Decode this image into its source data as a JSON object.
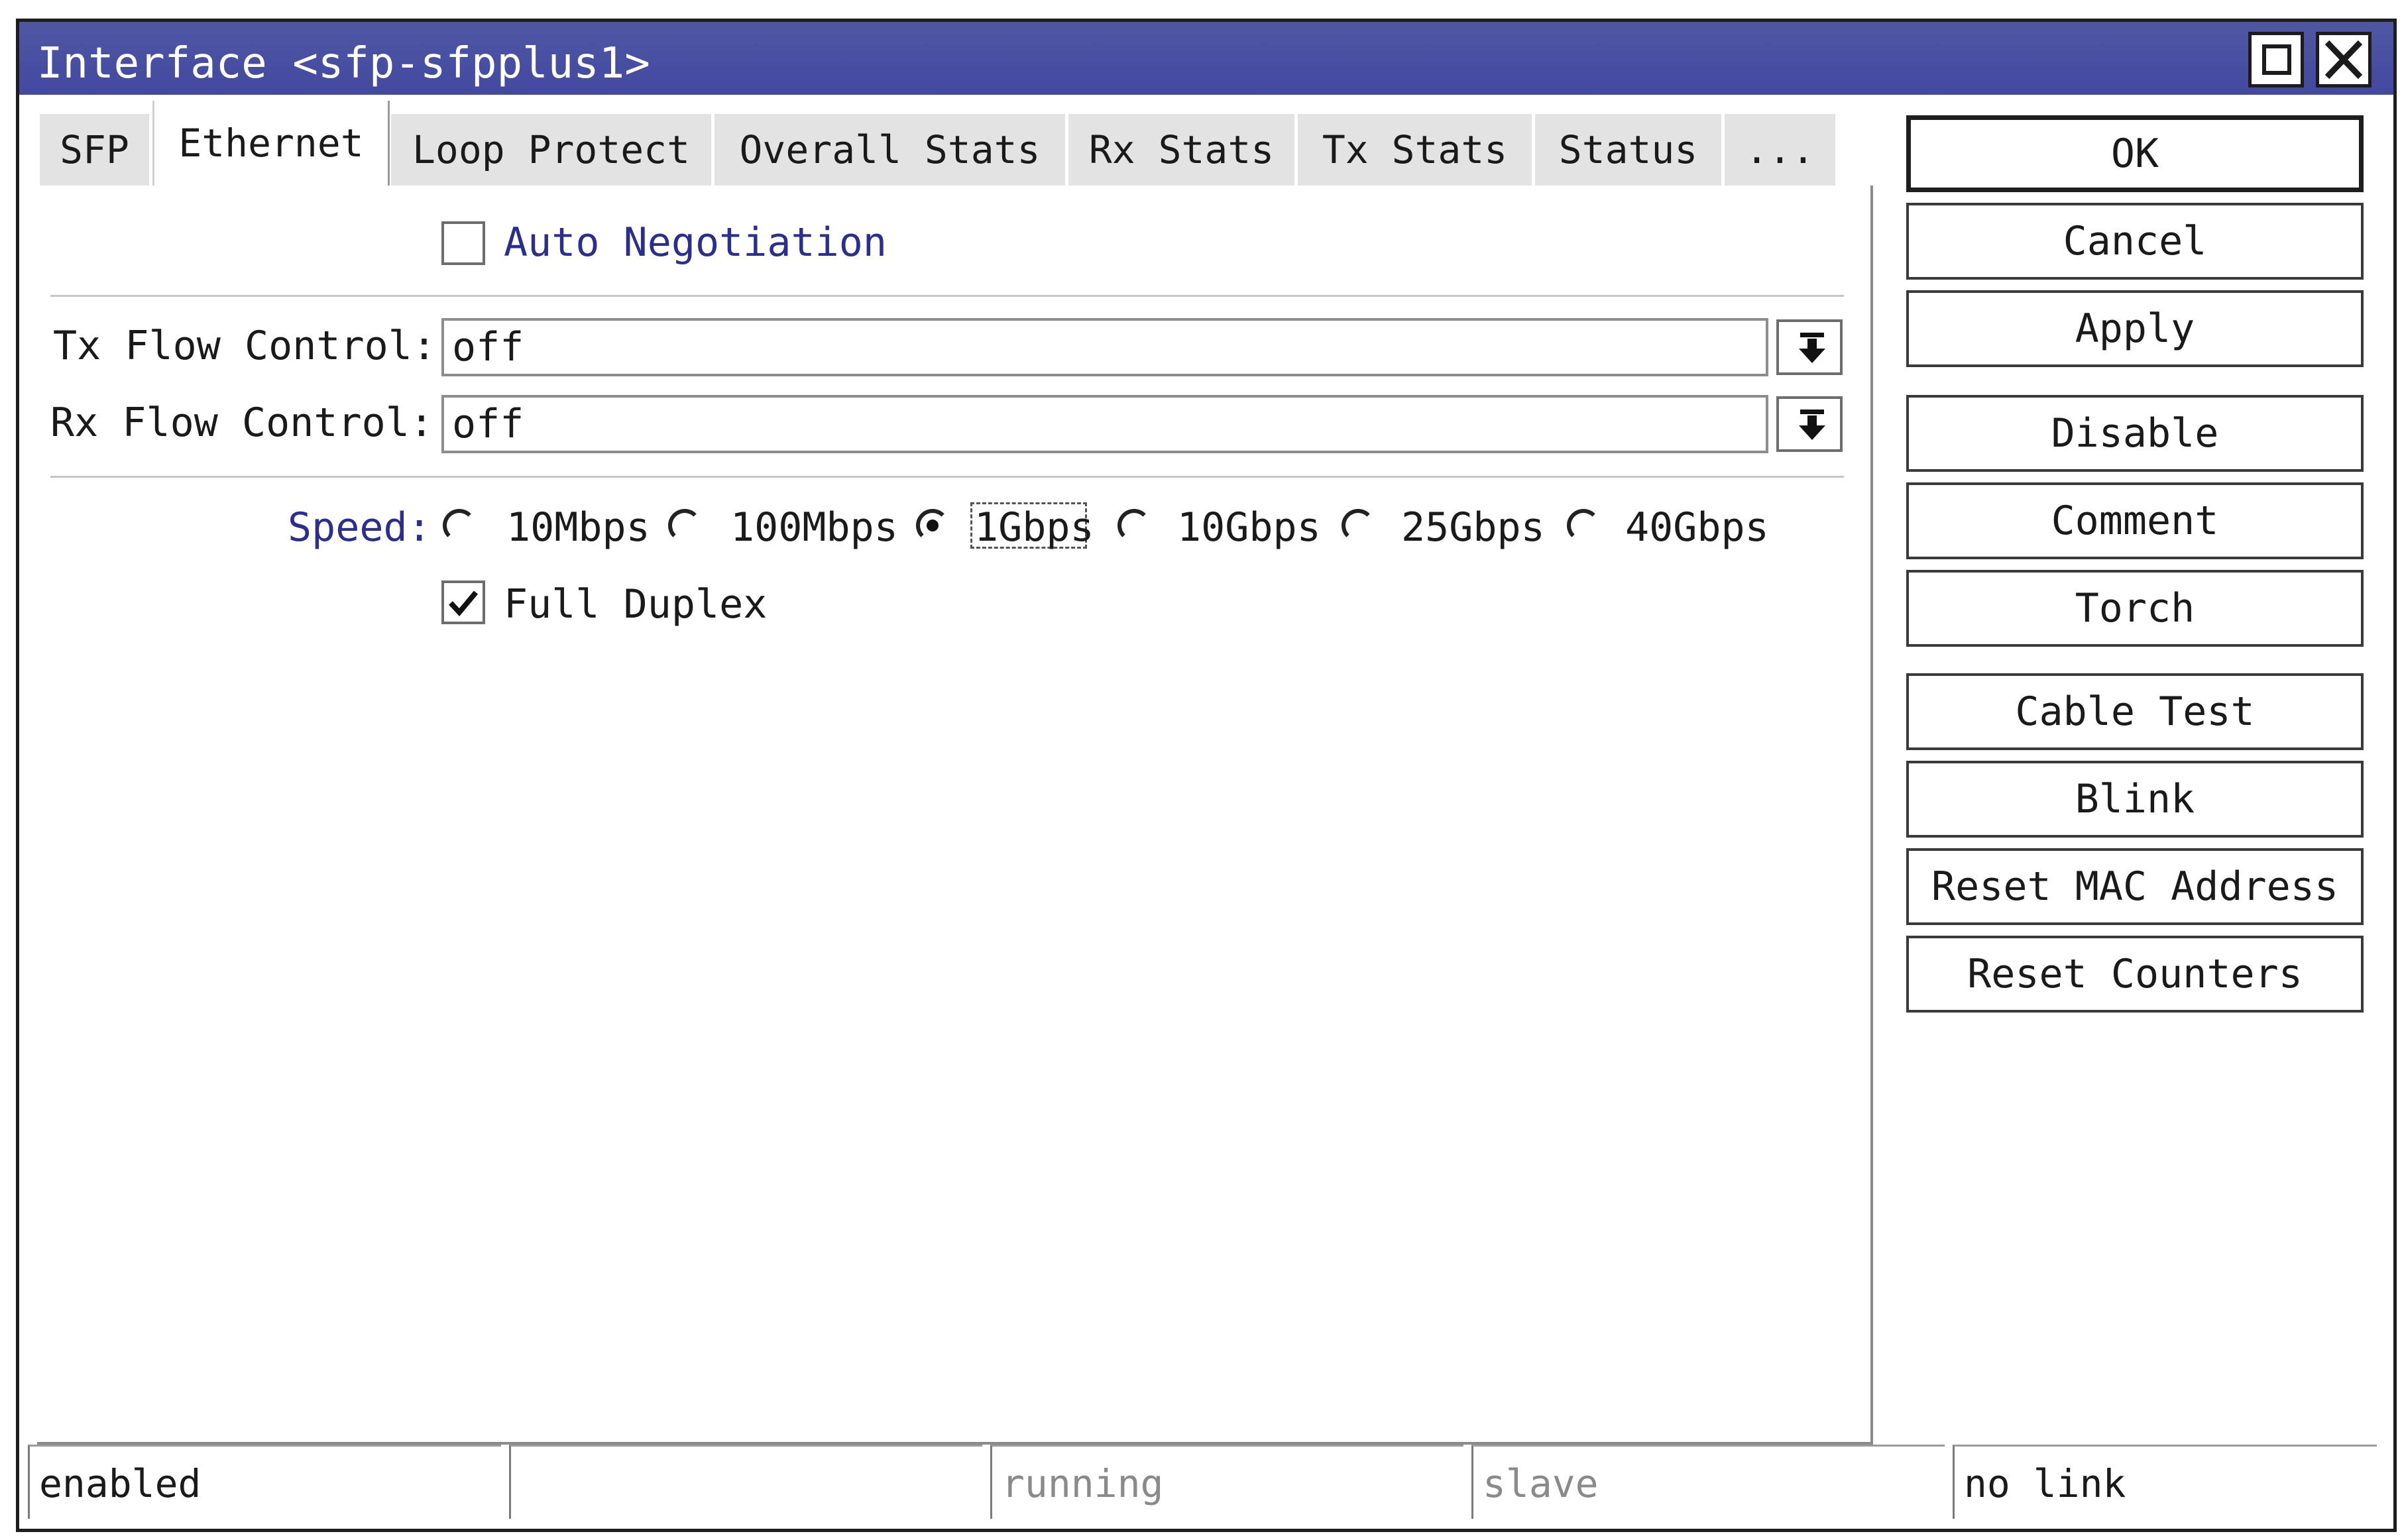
{
  "window": {
    "title": "Interface <sfp-sfpplus1>"
  },
  "tabs": [
    {
      "label": "SFP",
      "active": false
    },
    {
      "label": "Ethernet",
      "active": true
    },
    {
      "label": "Loop Protect",
      "active": false
    },
    {
      "label": "Overall Stats",
      "active": false
    },
    {
      "label": "Rx Stats",
      "active": false
    },
    {
      "label": "Tx Stats",
      "active": false
    },
    {
      "label": "Status",
      "active": false
    },
    {
      "label": "...",
      "active": false
    }
  ],
  "ethernet": {
    "auto_negotiation": {
      "label": "Auto Negotiation",
      "checked": false
    },
    "tx_flow_control": {
      "label": "Tx Flow Control:",
      "value": "off"
    },
    "rx_flow_control": {
      "label": "Rx Flow Control:",
      "value": "off"
    },
    "speed": {
      "label": "Speed:",
      "options": [
        "10Mbps",
        "100Mbps",
        "1Gbps",
        "10Gbps",
        "25Gbps",
        "40Gbps"
      ],
      "selected": "1Gbps"
    },
    "full_duplex": {
      "label": "Full Duplex",
      "checked": true
    }
  },
  "buttons": {
    "ok": "OK",
    "cancel": "Cancel",
    "apply": "Apply",
    "disable": "Disable",
    "comment": "Comment",
    "torch": "Torch",
    "cable_test": "Cable Test",
    "blink": "Blink",
    "reset_mac": "Reset MAC Address",
    "reset_counters": "Reset Counters"
  },
  "status_bar": [
    "enabled",
    "",
    "running",
    "slave",
    "no link"
  ],
  "colors": {
    "titlebar": "#4249a0",
    "label_blue": "#2a2f8f",
    "tab_inactive": "#e3e3e3"
  },
  "icons": {
    "maximize": "maximize-icon",
    "close": "close-icon",
    "dropdown": "dropdown-arrow-icon",
    "check": "checkmark-icon"
  }
}
